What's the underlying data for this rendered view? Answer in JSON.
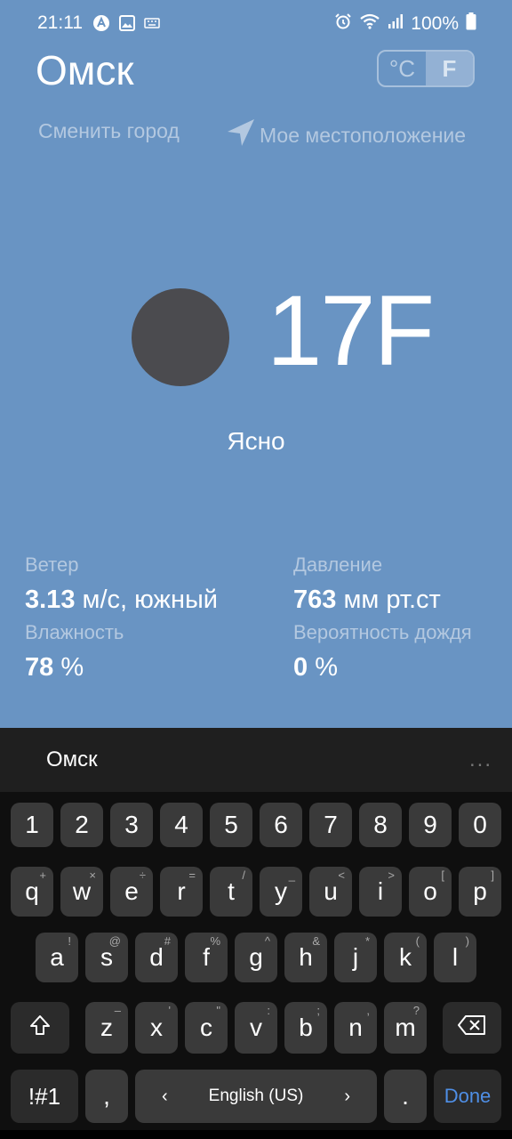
{
  "status_bar": {
    "time": "21:11",
    "battery": "100%"
  },
  "header": {
    "city": "Омск",
    "unit_celsius": "°C",
    "unit_fahrenheit": "F"
  },
  "links": {
    "change_city": "Сменить город",
    "my_location": "Мое местоположение"
  },
  "weather": {
    "temperature": "17F",
    "condition": "Ясно"
  },
  "details": {
    "wind_label": "Ветер",
    "wind_value": "3.13",
    "wind_unit": "м/с, южный",
    "pressure_label": "Давление",
    "pressure_value": "763",
    "pressure_unit": "мм рт.ст",
    "humidity_label": "Влажность",
    "humidity_value": "78",
    "humidity_unit": "%",
    "rain_label": "Вероятность дождя",
    "rain_value": "0",
    "rain_unit": "%"
  },
  "suggestion": {
    "word": "Омск",
    "more": "..."
  },
  "keyboard": {
    "row_numbers": [
      "1",
      "2",
      "3",
      "4",
      "5",
      "6",
      "7",
      "8",
      "9",
      "0"
    ],
    "row1": [
      {
        "k": "q",
        "h": "+"
      },
      {
        "k": "w",
        "h": "×"
      },
      {
        "k": "e",
        "h": "÷"
      },
      {
        "k": "r",
        "h": "="
      },
      {
        "k": "t",
        "h": "/"
      },
      {
        "k": "y",
        "h": "_"
      },
      {
        "k": "u",
        "h": "<"
      },
      {
        "k": "i",
        "h": ">"
      },
      {
        "k": "o",
        "h": "["
      },
      {
        "k": "p",
        "h": "]"
      }
    ],
    "row2": [
      {
        "k": "a",
        "h": "!"
      },
      {
        "k": "s",
        "h": "@"
      },
      {
        "k": "d",
        "h": "#"
      },
      {
        "k": "f",
        "h": "%"
      },
      {
        "k": "g",
        "h": "^"
      },
      {
        "k": "h",
        "h": "&"
      },
      {
        "k": "j",
        "h": "*"
      },
      {
        "k": "k",
        "h": "("
      },
      {
        "k": "l",
        "h": ")"
      }
    ],
    "row3": [
      {
        "k": "z",
        "h": "–"
      },
      {
        "k": "x",
        "h": "'"
      },
      {
        "k": "c",
        "h": "\""
      },
      {
        "k": "v",
        "h": ":"
      },
      {
        "k": "b",
        "h": ";"
      },
      {
        "k": "n",
        "h": ","
      },
      {
        "k": "m",
        "h": "?"
      }
    ],
    "symbols_label": "!#1",
    "comma": ",",
    "space_label": "English (US)",
    "period": ".",
    "done_label": "Done",
    "shift_icon": "shift-icon",
    "backspace_icon": "backspace-icon"
  }
}
